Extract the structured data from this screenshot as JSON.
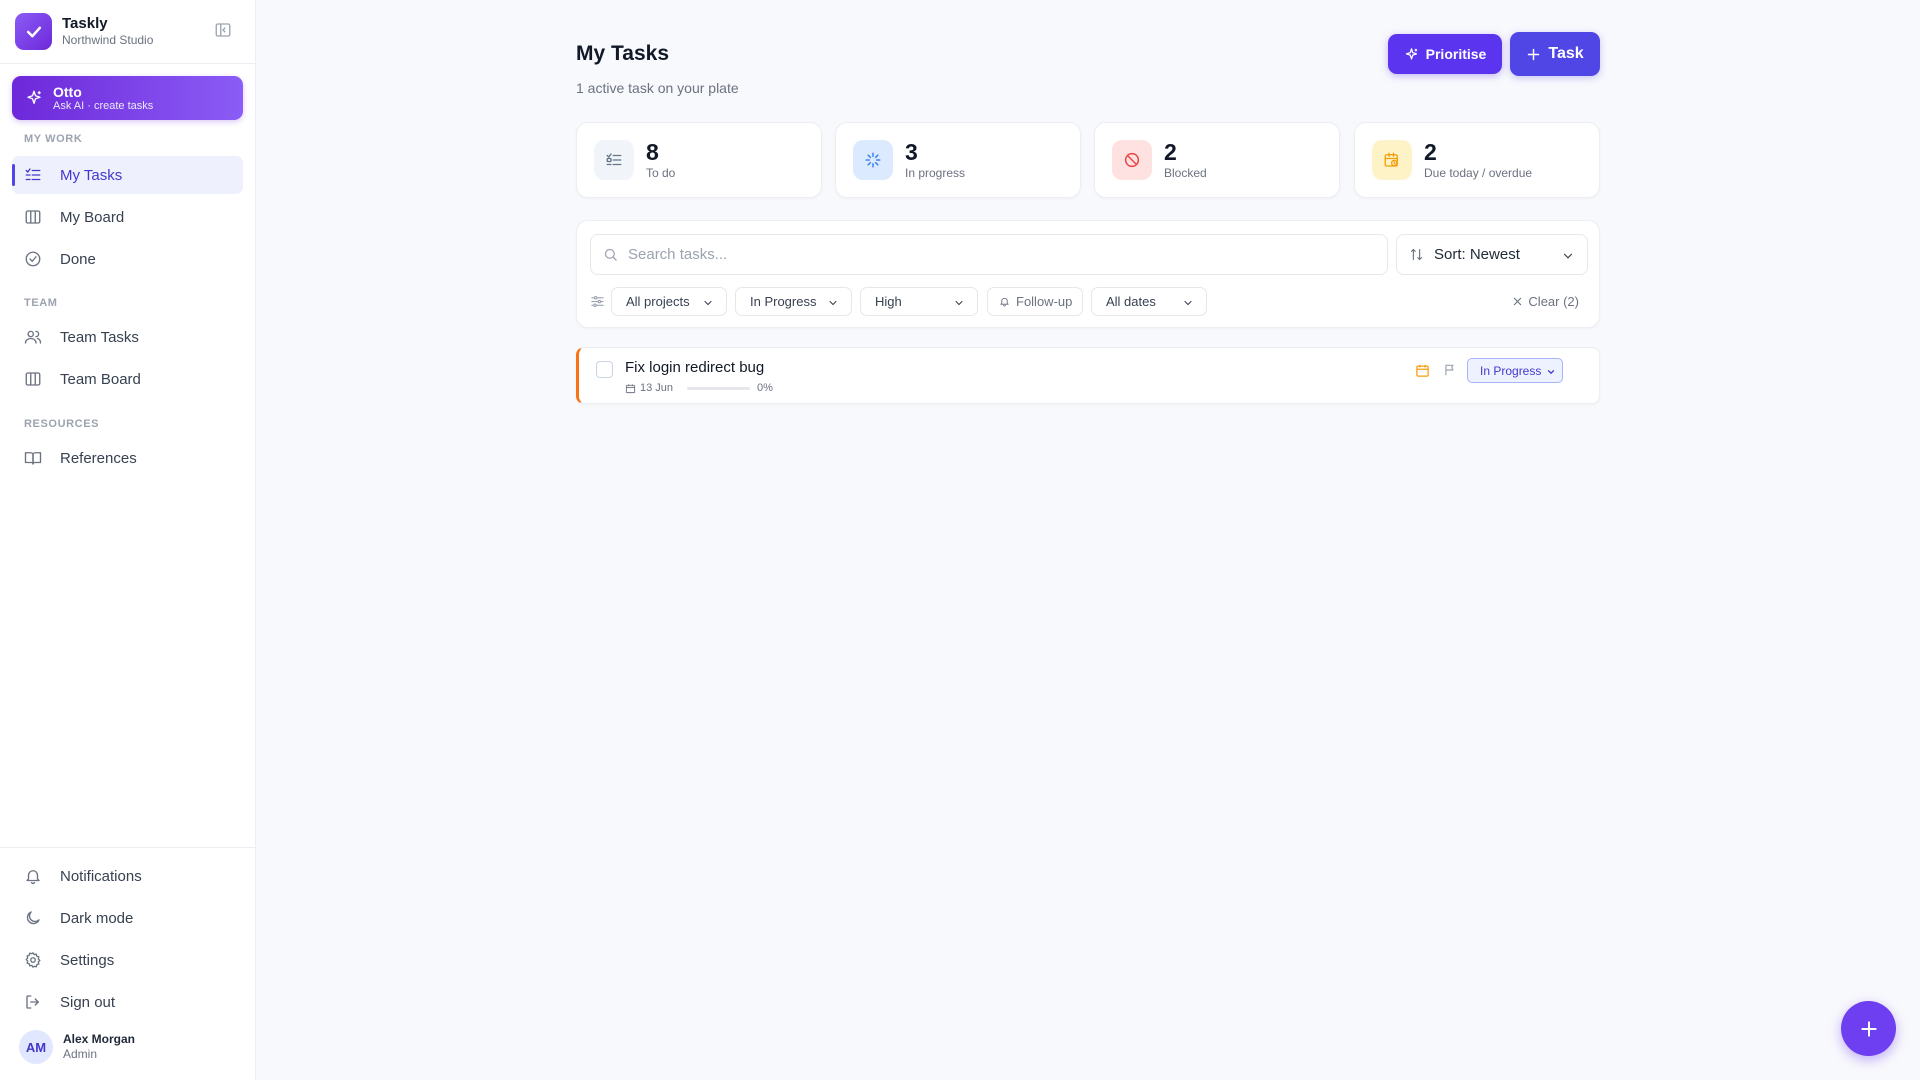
{
  "app": {
    "name": "Taskly",
    "workspace": "Northwind Studio"
  },
  "assistant": {
    "title": "Otto",
    "subtitle": "Ask AI · create tasks"
  },
  "sidebar": {
    "sections": [
      {
        "label": "MY WORK"
      },
      {
        "label": "TEAM"
      },
      {
        "label": "RESOURCES"
      }
    ],
    "items": [
      {
        "label": "My Tasks",
        "icon": "list-check-icon",
        "active": true
      },
      {
        "label": "My Board",
        "icon": "board-columns-icon"
      },
      {
        "label": "Done",
        "icon": "check-circle-icon"
      },
      {
        "label": "Team Tasks",
        "icon": "users-icon"
      },
      {
        "label": "Team Board",
        "icon": "board-columns-icon"
      },
      {
        "label": "References",
        "icon": "book-open-icon"
      }
    ],
    "bottom": [
      {
        "label": "Notifications",
        "icon": "bell-icon"
      },
      {
        "label": "Dark mode",
        "icon": "moon-icon"
      },
      {
        "label": "Settings",
        "icon": "gear-icon"
      },
      {
        "label": "Sign out",
        "icon": "sign-out-icon"
      }
    ]
  },
  "user": {
    "initials": "AM",
    "name": "Alex Morgan",
    "role": "Admin"
  },
  "header": {
    "title": "My Tasks",
    "subtitle": "1 active task on your plate",
    "prioritise_label": "Prioritise",
    "task_label": "Task"
  },
  "stats": [
    {
      "value": "8",
      "label": "To do",
      "icon": "list-icon",
      "color": "#64748b"
    },
    {
      "value": "3",
      "label": "In progress",
      "icon": "spinner-icon",
      "color": "#3b82f6"
    },
    {
      "value": "2",
      "label": "Blocked",
      "icon": "ban-icon",
      "color": "#ef4444"
    },
    {
      "value": "2",
      "label": "Due today / overdue",
      "icon": "calendar-clock-icon",
      "color": "#f59e0b"
    }
  ],
  "filters": {
    "search_placeholder": "Search tasks...",
    "sort_label": "Sort: Newest",
    "chips": [
      {
        "label": "All projects"
      },
      {
        "label": "In Progress"
      },
      {
        "label": "High"
      },
      {
        "label": "Follow-up"
      },
      {
        "label": "All dates"
      }
    ],
    "clear_label": "Clear (2)"
  },
  "tasks": [
    {
      "title": "Fix login redirect bug",
      "date": "13 Jun",
      "progress": 0,
      "progress_label": "0%",
      "status": "In Progress",
      "priority_color": "#f97316"
    }
  ],
  "colors": {
    "accent": "#4f46e5",
    "ai_gradient_start": "#6d28d9",
    "ai_gradient_end": "#8b5cf6",
    "background": "#f8f9fc"
  }
}
